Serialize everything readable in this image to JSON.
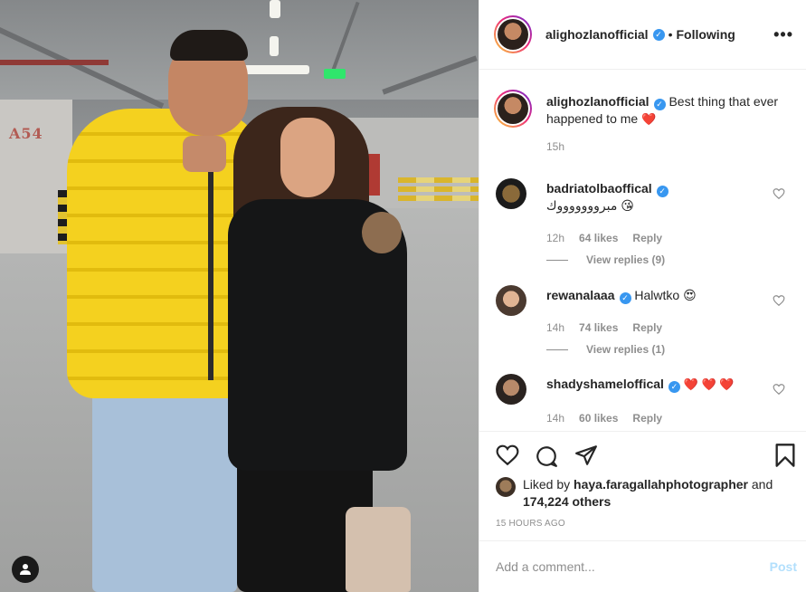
{
  "post": {
    "author": "alighozlanofficial",
    "follow_status": "Following",
    "separator": "•",
    "more_label": "•••",
    "caption": "Best thing that ever happened to me",
    "caption_emoji": "❤️",
    "caption_time": "15h"
  },
  "photo": {
    "wall_label": "A54",
    "user_tag_icon": "person-icon"
  },
  "comments": [
    {
      "user": "badriatolbaoffical",
      "text": "مبروووووووك",
      "emoji": "😘",
      "time": "12h",
      "likes": "64 likes",
      "reply": "Reply",
      "view_replies": "View replies (9)"
    },
    {
      "user": "rewanalaaa",
      "text": "Halwtko",
      "emoji": "😍",
      "time": "14h",
      "likes": "74 likes",
      "reply": "Reply",
      "view_replies": "View replies (1)"
    },
    {
      "user": "shadyshameloffical",
      "text": "",
      "emoji": "❤️ ❤️ ❤️",
      "time": "14h",
      "likes": "60 likes",
      "reply": "Reply"
    }
  ],
  "likes": {
    "prefix": "Liked by",
    "user": "haya.faragallahphotographer",
    "and": "and",
    "others": "174,224 others"
  },
  "timestamp": "15 HOURS AGO",
  "composer": {
    "placeholder": "Add a comment...",
    "post_label": "Post"
  },
  "colors": {
    "verified": "#3897f0",
    "post_disabled": "#b2dffc",
    "muted": "#8e8e8e",
    "text": "#262626"
  }
}
